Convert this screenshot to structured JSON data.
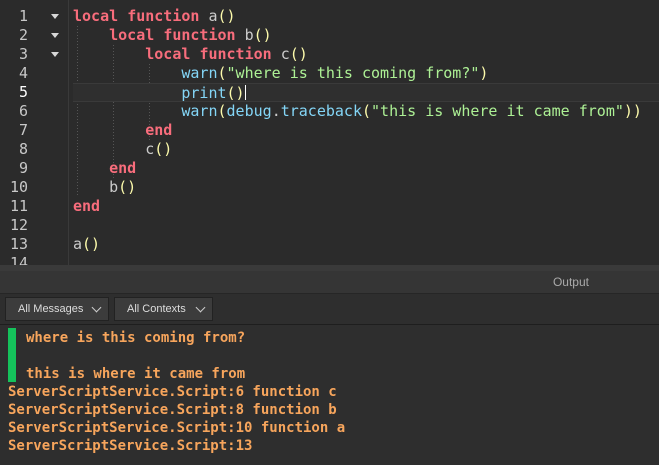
{
  "editor": {
    "line_numbers": [
      "1",
      "2",
      "3",
      "4",
      "5",
      "6",
      "7",
      "8",
      "9",
      "10",
      "11",
      "12",
      "13",
      "14"
    ],
    "current_line": "5",
    "lines": {
      "l1": {
        "kw1": "local",
        "kw2": "function",
        "name": "a",
        "p": "()"
      },
      "l2": {
        "kw1": "local",
        "kw2": "function",
        "name": "b",
        "p": "()"
      },
      "l3": {
        "kw1": "local",
        "kw2": "function",
        "name": "c",
        "p": "()"
      },
      "l4": {
        "fn": "warn",
        "open": "(",
        "str": "\"where is this coming from?\"",
        "close": ")"
      },
      "l5": {
        "fn": "print",
        "p": "()"
      },
      "l6": {
        "fn": "warn",
        "open": "(",
        "obj": "debug",
        "dot": ".",
        "method": "traceback",
        "open2": "(",
        "str": "\"this is where it came from\"",
        "close": "))"
      },
      "l7": {
        "kw": "end"
      },
      "l8": {
        "name": "c",
        "p": "()"
      },
      "l9": {
        "kw": "end"
      },
      "l10": {
        "name": "b",
        "p": "()"
      },
      "l11": {
        "kw": "end"
      },
      "l13": {
        "name": "a",
        "p": "()"
      }
    }
  },
  "output": {
    "title": "Output",
    "filter_messages": "All Messages",
    "filter_contexts": "All Contexts",
    "messages": [
      "where is this coming from?",
      "this is where it came from",
      "ServerScriptService.Script:6 function c",
      "ServerScriptService.Script:8 function b",
      "ServerScriptService.Script:10 function a",
      "ServerScriptService.Script:13"
    ],
    "message_color": "#f7a55c",
    "marker_color": "#15c25b"
  }
}
